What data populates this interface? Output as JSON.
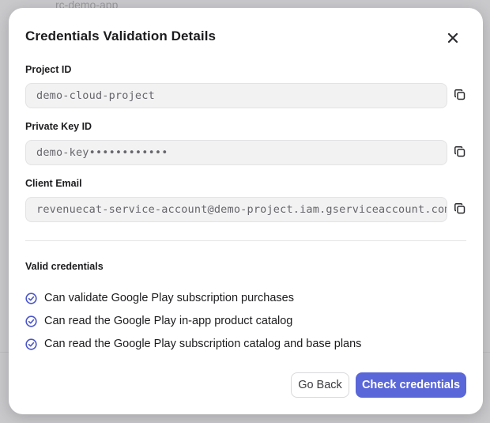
{
  "background": {
    "peek_text": "rc-demo-app"
  },
  "modal": {
    "title": "Credentials Validation Details",
    "fields": [
      {
        "label": "Project ID",
        "value": "demo-cloud-project"
      },
      {
        "label": "Private Key ID",
        "value": "demo-key••••••••••••"
      },
      {
        "label": "Client Email",
        "value": "revenuecat-service-account@demo-project.iam.gserviceaccount.com"
      }
    ],
    "section_title": "Valid credentials",
    "checks": [
      "Can validate Google Play subscription purchases",
      "Can read the Google Play in-app product catalog",
      "Can read the Google Play subscription catalog and base plans"
    ],
    "buttons": {
      "back": "Go Back",
      "check": "Check credentials"
    }
  },
  "colors": {
    "accent": "#5a67d8",
    "check_icon": "#4a55c9"
  },
  "icons": {
    "close": "close-icon",
    "copy": "copy-icon",
    "check": "check-circle-icon"
  }
}
